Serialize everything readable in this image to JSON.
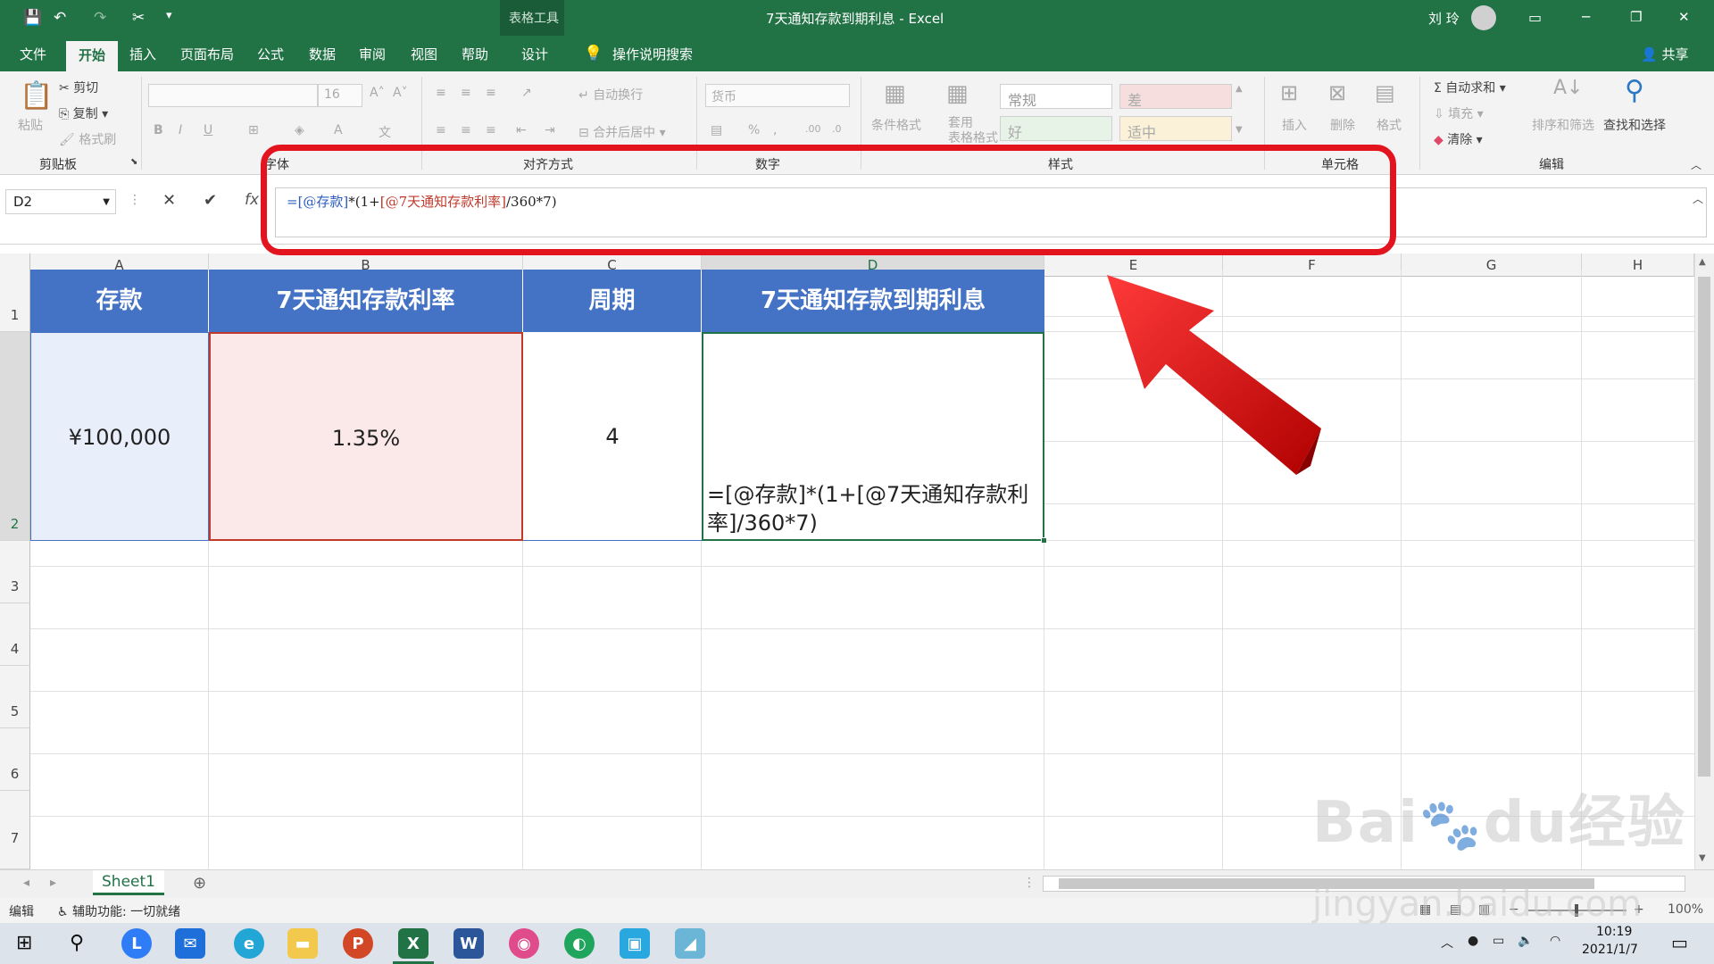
{
  "titlebar": {
    "tools_label": "表格工具",
    "doc_title": "7天通知存款到期利息 - Excel",
    "user": "刘 玲"
  },
  "tabs": [
    "文件",
    "开始",
    "插入",
    "页面布局",
    "公式",
    "数据",
    "审阅",
    "视图",
    "帮助",
    "设计"
  ],
  "tell_me": "操作说明搜索",
  "share": "共享",
  "ribbon": {
    "clipboard": {
      "paste": "粘贴",
      "cut": "剪切",
      "copy": "复制",
      "format_painter": "格式刷",
      "group": "剪贴板"
    },
    "font": {
      "size": "16",
      "group": "字体"
    },
    "alignment": {
      "wrap": "自动换行",
      "merge": "合并后居中",
      "group": "对齐方式"
    },
    "number": {
      "format": "货币",
      "group": "数字"
    },
    "styles": {
      "conditional": "条件格式",
      "table_format": "套用\n表格格式",
      "normal": "常规",
      "bad": "差",
      "good": "好",
      "neutral": "适中",
      "group": "样式"
    },
    "cells": {
      "insert": "插入",
      "delete": "删除",
      "format": "格式",
      "group": "单元格"
    },
    "editing": {
      "autosum": "自动求和",
      "fill": "填充",
      "clear": "清除",
      "sort": "排序和筛选",
      "find": "查找和选择",
      "group": "编辑"
    }
  },
  "formula_bar": {
    "name_box": "D2",
    "fx": "fx",
    "f1": "=[@存款]",
    "f2": "*(1+",
    "f3": "[@7天通知存款利率]",
    "f4": "/360*7)"
  },
  "columns": [
    "A",
    "B",
    "C",
    "D",
    "E",
    "F",
    "G",
    "H"
  ],
  "rows": [
    "1",
    "2",
    "3",
    "4",
    "5",
    "6",
    "7"
  ],
  "table": {
    "headers": [
      "存款",
      "7天通知存款利率",
      "周期",
      "7天通知存款到期利息"
    ],
    "row1": [
      "¥100,000",
      "1.35%",
      "4",
      "=[@存款]*(1+[@7天通知存款利率]/360*7)"
    ]
  },
  "sheet_tab": "Sheet1",
  "status": {
    "mode": "编辑",
    "accessibility": "辅助功能: 一切就绪",
    "zoom": "100%"
  },
  "taskbar": {
    "time": "10:19",
    "date": "2021/1/7"
  },
  "watermark": "Baidu经验 jingyan.baidu.com",
  "colors": {
    "excel_green": "#217346",
    "header_blue": "#4472c4",
    "cell_a": "#e8effa",
    "cell_b": "#fbe9ea",
    "callout_red": "#e3141e"
  }
}
